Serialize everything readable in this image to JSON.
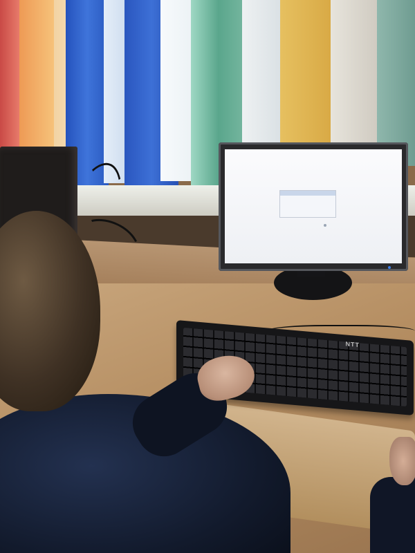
{
  "scene": {
    "description_tags": [
      "window-blinds",
      "computer-monitor",
      "keyboard",
      "person",
      "desk"
    ],
    "keyboard_brand": "NTT",
    "colors": {
      "blind_red": "#d9605a",
      "blind_orange": "#f0a860",
      "blind_blue": "#2f5cc4",
      "blind_white": "#eef2f6",
      "blind_green": "#5fa88e",
      "blind_yellow": "#e8c25a",
      "screen": "#f7f8fb",
      "desk": "#b58e62",
      "hoodie": "#16203a"
    }
  }
}
